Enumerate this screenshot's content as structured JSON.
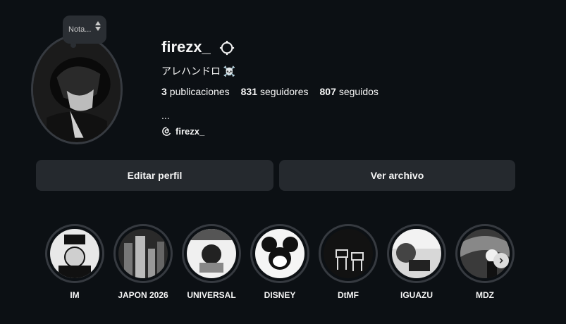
{
  "profile": {
    "username": "firezx_",
    "nickname": "アレハンドロ ☠️",
    "note_label": "Nota...",
    "bio": "...",
    "threads_handle": "firezx_"
  },
  "stats": {
    "posts_count": "3",
    "posts_label": "publicaciones",
    "followers_count": "831",
    "followers_label": "seguidores",
    "following_count": "807",
    "following_label": "seguidos"
  },
  "buttons": {
    "edit_profile": "Editar perfil",
    "view_archive": "Ver archivo"
  },
  "highlights": [
    {
      "label": "IM"
    },
    {
      "label": "JAPON 2026"
    },
    {
      "label": "UNIVERSAL"
    },
    {
      "label": "DISNEY"
    },
    {
      "label": "DtMF"
    },
    {
      "label": "IGUAZU"
    },
    {
      "label": "MDZ"
    }
  ],
  "icons": {
    "settings": "gear-icon",
    "threads": "threads-icon",
    "next": "chevron-right-icon"
  }
}
